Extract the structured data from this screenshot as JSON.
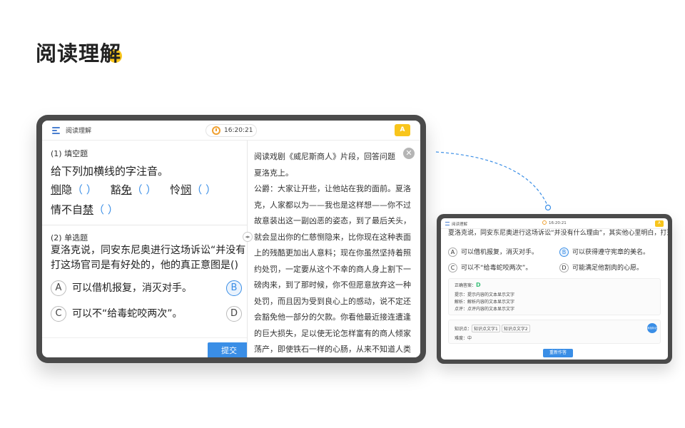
{
  "page": {
    "title": "阅读理解"
  },
  "app": {
    "title": "阅读理解",
    "time": "16:20:21",
    "font_button": "A"
  },
  "q1": {
    "label": "(1) 填空题",
    "stem": "给下列加横线的字注音。",
    "items": [
      {
        "pre": "",
        "ul": "恻",
        "post": "隐"
      },
      {
        "pre": "豁",
        "ul": "免",
        "post": ""
      },
      {
        "pre": "怜",
        "ul": "悯",
        "post": ""
      },
      {
        "pre": "情不自",
        "ul": "禁",
        "post": ""
      }
    ],
    "paren": "（    ）"
  },
  "q2": {
    "label": "(2) 单选题",
    "stem_line1": "夏洛克说，同安东尼奥进行这场诉讼“并没有",
    "stem_line2": "打这场官司是有好处的，他的真正意图是()",
    "options": [
      {
        "key": "A",
        "text": "可以借机报复，消灭对手。"
      },
      {
        "key": "B",
        "text": ""
      },
      {
        "key": "C",
        "text": "可以不“给毒蛇咬两次”。"
      },
      {
        "key": "D",
        "text": ""
      }
    ],
    "submit": "提交"
  },
  "passage": {
    "intro": "阅读戏剧《威尼斯商人》片段，回答问题",
    "speaker": "夏洛克上。",
    "body": "公爵：大家让开些，让他站在我的面前。夏洛克，人家都以为——我也是这样想——你不过故意装出这一副凶恶的姿态，到了最后关头，就会显出你的仁慈恻隐来，比你现在这种表面上的残酷更加出人意料；现在你虽然坚持着照约处罚，一定要从这个不幸的商人身上割下一磅肉来，到了那时候，你不但愿意放弃这一种处罚，而且因为受到良心上的感动，说不定还会豁免他一部分的欠款。你看他最近接连遭逢的巨大损失，足以使无论怎样富有的商人倾家荡产，即使铁石一样的心肠，从来不知道人类同情的野蛮人，也不能不对他的境遇发生怜"
  },
  "small": {
    "app_title": "阅读理解",
    "time": "16:20:21",
    "font_button": "A",
    "cut_line": "夏洛克说，同安东尼奥进行这场诉讼“并没有什么理由”，其实他心里明白，打这场官司是有好处的，他的真正意图是()",
    "options": [
      {
        "key": "A",
        "text": "可以借机报复，消灭对手。"
      },
      {
        "key": "B",
        "text": "可以获得遵守宪章的美名。"
      },
      {
        "key": "C",
        "text": "可以不“给毒蛇咬两次”。"
      },
      {
        "key": "D",
        "text": "可能满足他割肉的心愿。"
      }
    ],
    "answer_label": "正确答案：",
    "answer": "D",
    "hint": "提示：提示内容的文本显示文字",
    "analysis": "解析：解析内容的文本显示文字",
    "comment": "点评：点评内容的文本显示文字",
    "knowledge_label": "知识点：",
    "knowledge_tags": [
      "知识点文字1",
      "知识点文字2"
    ],
    "difficulty": "难度：中",
    "circle_button": "添加标记",
    "redo_button": "重新作答"
  },
  "colors": {
    "accent": "#3a8ee6",
    "yellow": "#f8c51c",
    "frame": "#4a4a4a",
    "correct": "#3cc07a"
  }
}
